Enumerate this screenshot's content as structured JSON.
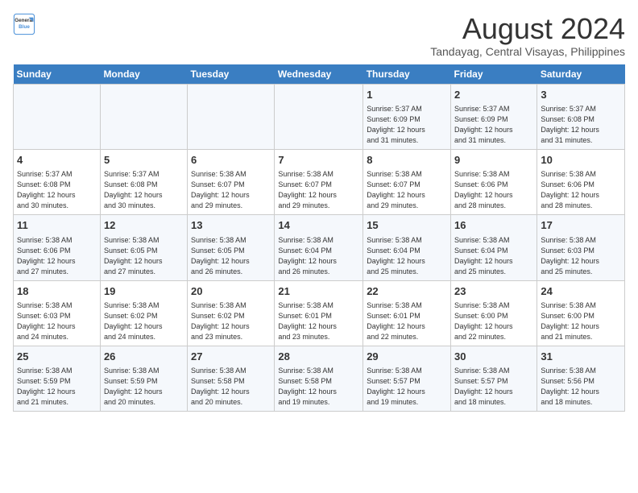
{
  "logo": {
    "line1": "General",
    "line2": "Blue"
  },
  "title": "August 2024",
  "subtitle": "Tandayag, Central Visayas, Philippines",
  "weekdays": [
    "Sunday",
    "Monday",
    "Tuesday",
    "Wednesday",
    "Thursday",
    "Friday",
    "Saturday"
  ],
  "weeks": [
    [
      {
        "day": "",
        "info": ""
      },
      {
        "day": "",
        "info": ""
      },
      {
        "day": "",
        "info": ""
      },
      {
        "day": "",
        "info": ""
      },
      {
        "day": "1",
        "info": "Sunrise: 5:37 AM\nSunset: 6:09 PM\nDaylight: 12 hours\nand 31 minutes."
      },
      {
        "day": "2",
        "info": "Sunrise: 5:37 AM\nSunset: 6:09 PM\nDaylight: 12 hours\nand 31 minutes."
      },
      {
        "day": "3",
        "info": "Sunrise: 5:37 AM\nSunset: 6:08 PM\nDaylight: 12 hours\nand 31 minutes."
      }
    ],
    [
      {
        "day": "4",
        "info": "Sunrise: 5:37 AM\nSunset: 6:08 PM\nDaylight: 12 hours\nand 30 minutes."
      },
      {
        "day": "5",
        "info": "Sunrise: 5:37 AM\nSunset: 6:08 PM\nDaylight: 12 hours\nand 30 minutes."
      },
      {
        "day": "6",
        "info": "Sunrise: 5:38 AM\nSunset: 6:07 PM\nDaylight: 12 hours\nand 29 minutes."
      },
      {
        "day": "7",
        "info": "Sunrise: 5:38 AM\nSunset: 6:07 PM\nDaylight: 12 hours\nand 29 minutes."
      },
      {
        "day": "8",
        "info": "Sunrise: 5:38 AM\nSunset: 6:07 PM\nDaylight: 12 hours\nand 29 minutes."
      },
      {
        "day": "9",
        "info": "Sunrise: 5:38 AM\nSunset: 6:06 PM\nDaylight: 12 hours\nand 28 minutes."
      },
      {
        "day": "10",
        "info": "Sunrise: 5:38 AM\nSunset: 6:06 PM\nDaylight: 12 hours\nand 28 minutes."
      }
    ],
    [
      {
        "day": "11",
        "info": "Sunrise: 5:38 AM\nSunset: 6:06 PM\nDaylight: 12 hours\nand 27 minutes."
      },
      {
        "day": "12",
        "info": "Sunrise: 5:38 AM\nSunset: 6:05 PM\nDaylight: 12 hours\nand 27 minutes."
      },
      {
        "day": "13",
        "info": "Sunrise: 5:38 AM\nSunset: 6:05 PM\nDaylight: 12 hours\nand 26 minutes."
      },
      {
        "day": "14",
        "info": "Sunrise: 5:38 AM\nSunset: 6:04 PM\nDaylight: 12 hours\nand 26 minutes."
      },
      {
        "day": "15",
        "info": "Sunrise: 5:38 AM\nSunset: 6:04 PM\nDaylight: 12 hours\nand 25 minutes."
      },
      {
        "day": "16",
        "info": "Sunrise: 5:38 AM\nSunset: 6:04 PM\nDaylight: 12 hours\nand 25 minutes."
      },
      {
        "day": "17",
        "info": "Sunrise: 5:38 AM\nSunset: 6:03 PM\nDaylight: 12 hours\nand 25 minutes."
      }
    ],
    [
      {
        "day": "18",
        "info": "Sunrise: 5:38 AM\nSunset: 6:03 PM\nDaylight: 12 hours\nand 24 minutes."
      },
      {
        "day": "19",
        "info": "Sunrise: 5:38 AM\nSunset: 6:02 PM\nDaylight: 12 hours\nand 24 minutes."
      },
      {
        "day": "20",
        "info": "Sunrise: 5:38 AM\nSunset: 6:02 PM\nDaylight: 12 hours\nand 23 minutes."
      },
      {
        "day": "21",
        "info": "Sunrise: 5:38 AM\nSunset: 6:01 PM\nDaylight: 12 hours\nand 23 minutes."
      },
      {
        "day": "22",
        "info": "Sunrise: 5:38 AM\nSunset: 6:01 PM\nDaylight: 12 hours\nand 22 minutes."
      },
      {
        "day": "23",
        "info": "Sunrise: 5:38 AM\nSunset: 6:00 PM\nDaylight: 12 hours\nand 22 minutes."
      },
      {
        "day": "24",
        "info": "Sunrise: 5:38 AM\nSunset: 6:00 PM\nDaylight: 12 hours\nand 21 minutes."
      }
    ],
    [
      {
        "day": "25",
        "info": "Sunrise: 5:38 AM\nSunset: 5:59 PM\nDaylight: 12 hours\nand 21 minutes."
      },
      {
        "day": "26",
        "info": "Sunrise: 5:38 AM\nSunset: 5:59 PM\nDaylight: 12 hours\nand 20 minutes."
      },
      {
        "day": "27",
        "info": "Sunrise: 5:38 AM\nSunset: 5:58 PM\nDaylight: 12 hours\nand 20 minutes."
      },
      {
        "day": "28",
        "info": "Sunrise: 5:38 AM\nSunset: 5:58 PM\nDaylight: 12 hours\nand 19 minutes."
      },
      {
        "day": "29",
        "info": "Sunrise: 5:38 AM\nSunset: 5:57 PM\nDaylight: 12 hours\nand 19 minutes."
      },
      {
        "day": "30",
        "info": "Sunrise: 5:38 AM\nSunset: 5:57 PM\nDaylight: 12 hours\nand 18 minutes."
      },
      {
        "day": "31",
        "info": "Sunrise: 5:38 AM\nSunset: 5:56 PM\nDaylight: 12 hours\nand 18 minutes."
      }
    ]
  ]
}
